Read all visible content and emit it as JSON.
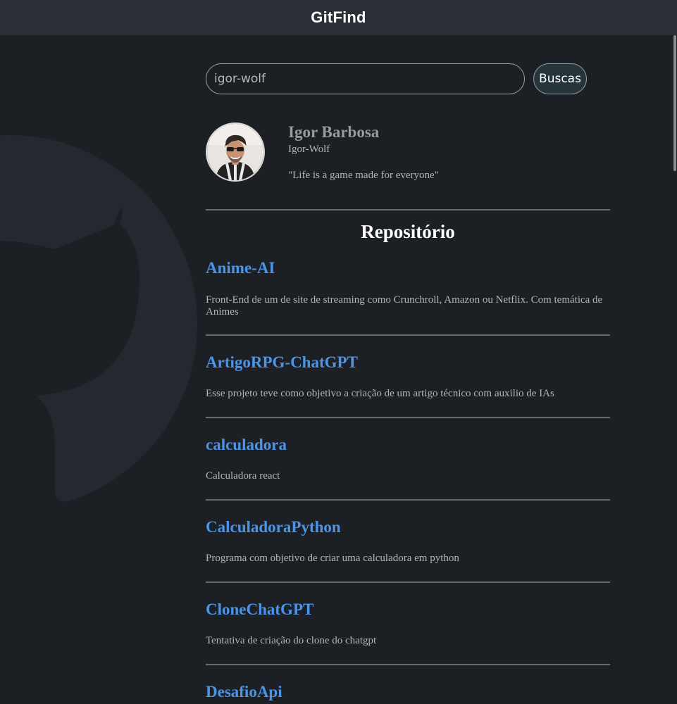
{
  "header": {
    "title": "GitFind"
  },
  "search": {
    "value": "igor-wolf",
    "button_label": "Buscas"
  },
  "profile": {
    "name": "Igor Barbosa",
    "login": "Igor-Wolf",
    "bio": "\"Life is a game made for everyone\""
  },
  "repos_section": {
    "title": "Repositório",
    "items": [
      {
        "name": "Anime-AI",
        "description": "Front-End de um de site de streaming como Crunchroll, Amazon ou Netflix. Com temática de Animes"
      },
      {
        "name": "ArtigoRPG-ChatGPT",
        "description": "Esse projeto teve como objetivo a criação de um artigo técnico com auxilio de IAs"
      },
      {
        "name": "calculadora",
        "description": "Calculadora react"
      },
      {
        "name": "CalculadoraPython",
        "description": "Programa com objetivo de criar uma calculadora em python"
      },
      {
        "name": "CloneChatGPT",
        "description": "Tentativa de criação do clone do chatgpt"
      },
      {
        "name": "DesafioApi",
        "description": ""
      }
    ]
  },
  "colors": {
    "background": "#1c1f24",
    "header_background": "#2b3038",
    "repo_link": "#4b94e8",
    "divider": "#666a6f",
    "button_background": "#25353a"
  },
  "icons": {
    "background_logo": "github-logo-icon"
  }
}
